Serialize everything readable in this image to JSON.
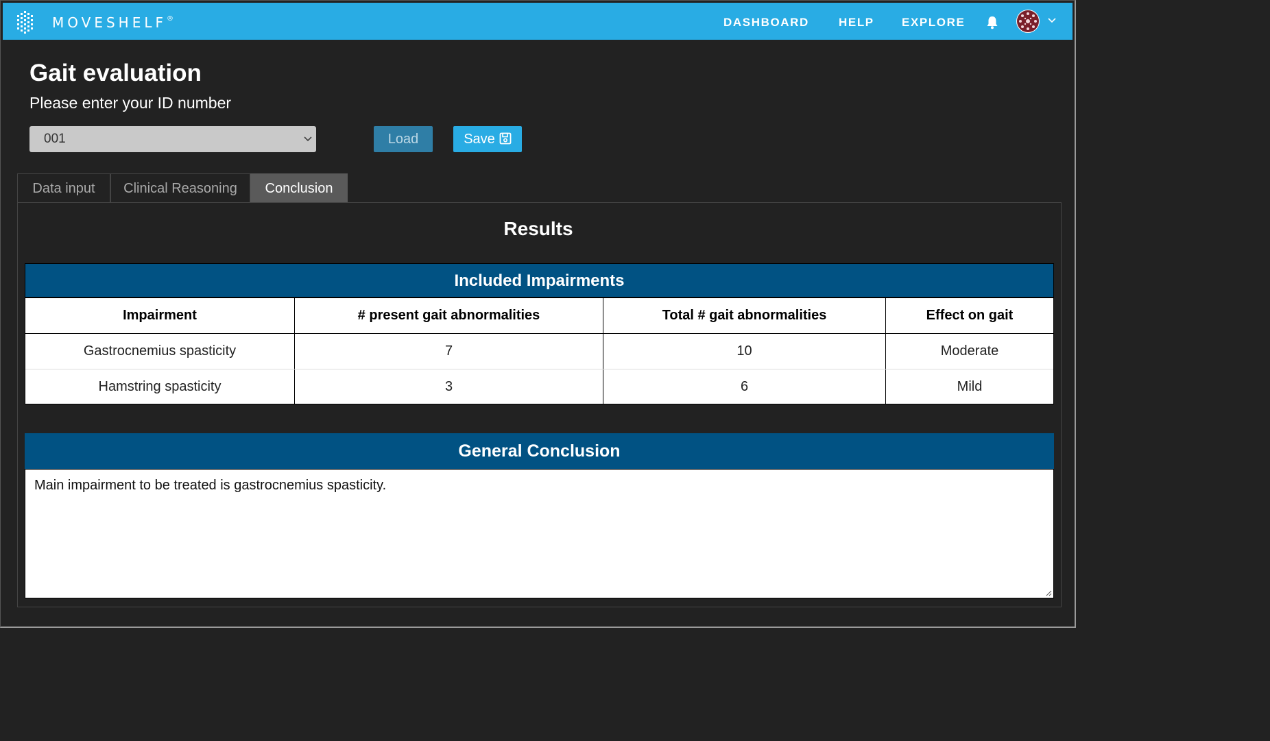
{
  "app": {
    "brand": "MOVESHELF",
    "brand_mark": "®"
  },
  "nav": {
    "items": [
      "DASHBOARD",
      "HELP",
      "EXPLORE"
    ],
    "icons": [
      "bell-icon",
      "avatar",
      "chevron-down-icon"
    ]
  },
  "header": {
    "title": "Gait evaluation",
    "subtitle": "Please enter your ID number"
  },
  "id_select": {
    "value": "001"
  },
  "buttons": {
    "load": "Load",
    "save": "Save"
  },
  "tabs": [
    {
      "label": "Data input",
      "active": false
    },
    {
      "label": "Clinical Reasoning",
      "active": false
    },
    {
      "label": "Conclusion",
      "active": true
    }
  ],
  "results": {
    "title": "Results",
    "impairments": {
      "header": "Included Impairments",
      "columns": [
        "Impairment",
        "# present gait abnormalities",
        "Total # gait abnormalities",
        "Effect on gait"
      ],
      "rows": [
        [
          "Gastrocnemius spasticity",
          "7",
          "10",
          "Moderate"
        ],
        [
          "Hamstring spasticity",
          "3",
          "6",
          "Mild"
        ]
      ]
    },
    "conclusion": {
      "header": "General Conclusion",
      "text": "Main impairment to be treated is gastrocnemius spasticity."
    }
  },
  "colors": {
    "topbar": "#29ace4",
    "table_header": "#015283",
    "background": "#222222"
  }
}
